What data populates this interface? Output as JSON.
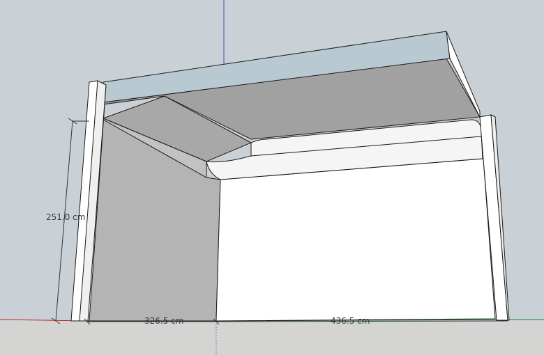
{
  "dimensions": {
    "height_label": "251.0 cm",
    "depth_label": "326.5 cm",
    "width_label": "436.5 cm"
  },
  "colors": {
    "sky": "#c9d1d6",
    "ground": "#d4d4d2",
    "red_axis": "#c62828",
    "green_axis": "#2e7d32",
    "blue_axis": "#3f51b5",
    "ceiling_underside": "#a1a1a1",
    "ceiling_top_face": "#b9c9d2",
    "left_wall": "#b4b4b4",
    "back_wall": "#ffffff",
    "beam_bottom": "#a8a8a8",
    "beam_side": "#c2c2c2",
    "cove_molding": "#f5f5f5",
    "edge_line": "#1a1a1a"
  },
  "icons": {
    "axes": "axis-gizmo-lines"
  }
}
